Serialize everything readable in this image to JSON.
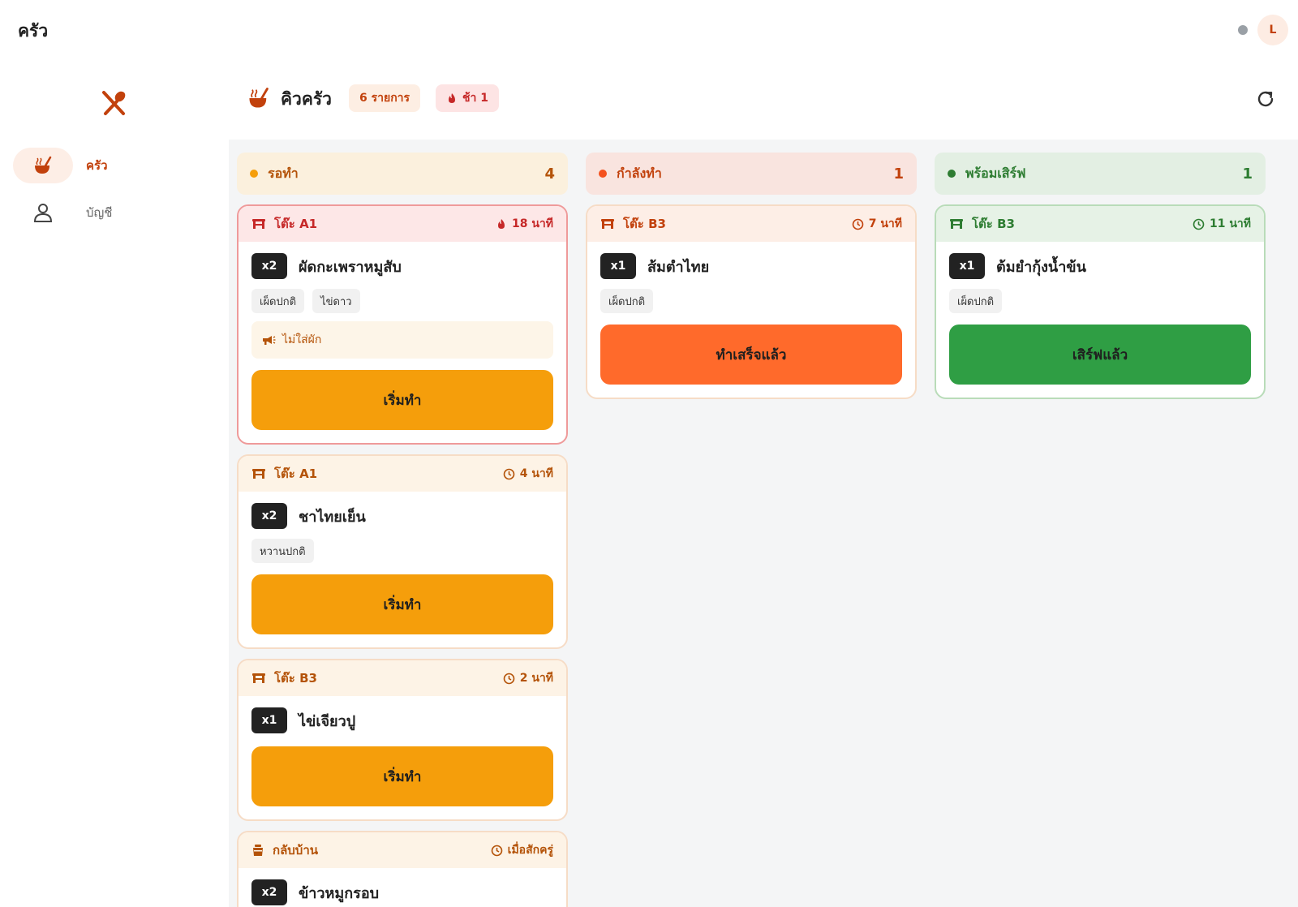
{
  "app": {
    "title": "ครัว",
    "avatar_initial": "L"
  },
  "sidebar": {
    "items": [
      {
        "label": "ครัว",
        "icon": "ladle-bowl-icon",
        "active": true
      },
      {
        "label": "บัญชี",
        "icon": "user-icon",
        "active": false
      }
    ]
  },
  "header": {
    "title": "คิวครัว",
    "count_badge": "6 รายการ",
    "late_badge": "ช้า 1"
  },
  "colors": {
    "accent": "#c2410c",
    "waiting": "#f59e0b",
    "cooking": "#ff6a2b",
    "ready": "#2f9e44",
    "late": "#c62828"
  },
  "columns": [
    {
      "title": "รอทำ",
      "count": "4",
      "cards": [
        {
          "table": "โต๊ะ A1",
          "time": "18 นาที",
          "late": true,
          "qty": "x2",
          "name": "ผัดกะเพราหมูสับ",
          "tags": [
            "เผ็ดปกติ",
            "ไข่ดาว"
          ],
          "note": "ไม่ใส่ผัก",
          "action": "เริ่มทำ"
        },
        {
          "table": "โต๊ะ A1",
          "time": "4 นาที",
          "late": false,
          "qty": "x2",
          "name": "ชาไทยเย็น",
          "tags": [
            "หวานปกติ"
          ],
          "note": "",
          "action": "เริ่มทำ"
        },
        {
          "table": "โต๊ะ B3",
          "time": "2 นาที",
          "late": false,
          "qty": "x1",
          "name": "ไข่เจียวปู",
          "tags": [],
          "note": "",
          "action": "เริ่มทำ"
        },
        {
          "table": "กลับบ้าน",
          "time": "เมื่อสักครู่",
          "late": false,
          "qty": "x2",
          "name": "ข้าวหมูกรอบ",
          "tags": [],
          "note": "",
          "action": ""
        }
      ]
    },
    {
      "title": "กำลังทำ",
      "count": "1",
      "cards": [
        {
          "table": "โต๊ะ B3",
          "time": "7 นาที",
          "late": false,
          "qty": "x1",
          "name": "ส้มตำไทย",
          "tags": [
            "เผ็ดปกติ"
          ],
          "note": "",
          "action": "ทำเสร็จแล้ว"
        }
      ]
    },
    {
      "title": "พร้อมเสิร์ฟ",
      "count": "1",
      "cards": [
        {
          "table": "โต๊ะ B3",
          "time": "11 นาที",
          "late": false,
          "qty": "x1",
          "name": "ต้มยำกุ้งน้ำข้น",
          "tags": [
            "เผ็ดปกติ"
          ],
          "note": "",
          "action": "เสิร์ฟแล้ว"
        }
      ]
    }
  ]
}
